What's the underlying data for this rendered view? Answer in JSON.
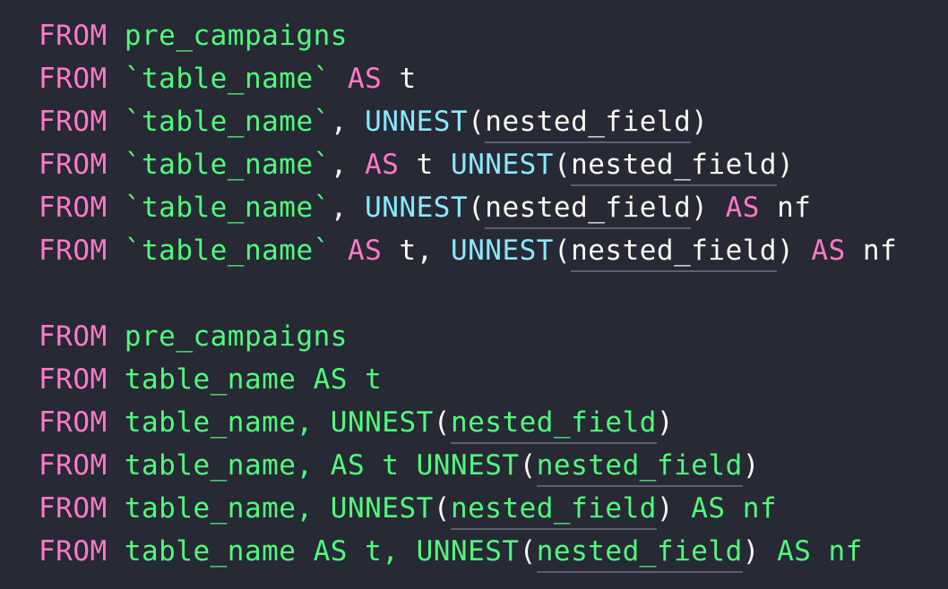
{
  "colors": {
    "background": "#272935",
    "keyword": "#ff79c6",
    "string": "#50fa7b",
    "function": "#8be9fd",
    "plain": "#f8f8f2",
    "underline": "#5b5f70"
  },
  "lines": [
    {
      "tokens": [
        {
          "t": "FROM",
          "c": "kw"
        },
        {
          "t": " ",
          "c": "plain"
        },
        {
          "t": "pre_campaigns",
          "c": "str"
        }
      ]
    },
    {
      "tokens": [
        {
          "t": "FROM",
          "c": "kw"
        },
        {
          "t": " ",
          "c": "plain"
        },
        {
          "t": "`table_name`",
          "c": "str"
        },
        {
          "t": " ",
          "c": "plain"
        },
        {
          "t": "AS",
          "c": "kw"
        },
        {
          "t": " t",
          "c": "plain"
        }
      ]
    },
    {
      "tokens": [
        {
          "t": "FROM",
          "c": "kw"
        },
        {
          "t": " ",
          "c": "plain"
        },
        {
          "t": "`table_name`",
          "c": "str"
        },
        {
          "t": ", ",
          "c": "plain"
        },
        {
          "t": "UNNEST",
          "c": "fn"
        },
        {
          "t": "(",
          "c": "plain"
        },
        {
          "t": "nested_field",
          "c": "plain",
          "u": true
        },
        {
          "t": ")",
          "c": "plain"
        }
      ]
    },
    {
      "tokens": [
        {
          "t": "FROM",
          "c": "kw"
        },
        {
          "t": " ",
          "c": "plain"
        },
        {
          "t": "`table_name`",
          "c": "str"
        },
        {
          "t": ", ",
          "c": "plain"
        },
        {
          "t": "AS",
          "c": "kw"
        },
        {
          "t": " t ",
          "c": "plain"
        },
        {
          "t": "UNNEST",
          "c": "fn"
        },
        {
          "t": "(",
          "c": "plain"
        },
        {
          "t": "nested_field",
          "c": "plain",
          "u": true
        },
        {
          "t": ")",
          "c": "plain"
        }
      ]
    },
    {
      "tokens": [
        {
          "t": "FROM",
          "c": "kw"
        },
        {
          "t": " ",
          "c": "plain"
        },
        {
          "t": "`table_name`",
          "c": "str"
        },
        {
          "t": ", ",
          "c": "plain"
        },
        {
          "t": "UNNEST",
          "c": "fn"
        },
        {
          "t": "(",
          "c": "plain"
        },
        {
          "t": "nested_field",
          "c": "plain",
          "u": true
        },
        {
          "t": ") ",
          "c": "plain"
        },
        {
          "t": "AS",
          "c": "kw"
        },
        {
          "t": " nf",
          "c": "plain"
        }
      ]
    },
    {
      "tokens": [
        {
          "t": "FROM",
          "c": "kw"
        },
        {
          "t": " ",
          "c": "plain"
        },
        {
          "t": "`table_name`",
          "c": "str"
        },
        {
          "t": " ",
          "c": "plain"
        },
        {
          "t": "AS",
          "c": "kw"
        },
        {
          "t": " t, ",
          "c": "plain"
        },
        {
          "t": "UNNEST",
          "c": "fn"
        },
        {
          "t": "(",
          "c": "plain"
        },
        {
          "t": "nested_field",
          "c": "plain",
          "u": true
        },
        {
          "t": ") ",
          "c": "plain"
        },
        {
          "t": "AS",
          "c": "kw"
        },
        {
          "t": " nf",
          "c": "plain"
        }
      ]
    },
    {
      "tokens": []
    },
    {
      "tokens": [
        {
          "t": "FROM",
          "c": "kw"
        },
        {
          "t": " ",
          "c": "plain"
        },
        {
          "t": "pre_campaigns",
          "c": "str"
        }
      ]
    },
    {
      "tokens": [
        {
          "t": "FROM",
          "c": "kw"
        },
        {
          "t": " ",
          "c": "plain"
        },
        {
          "t": "table_name AS t",
          "c": "str"
        }
      ]
    },
    {
      "tokens": [
        {
          "t": "FROM",
          "c": "kw"
        },
        {
          "t": " ",
          "c": "plain"
        },
        {
          "t": "table_name, UNNEST",
          "c": "str"
        },
        {
          "t": "(",
          "c": "plain"
        },
        {
          "t": "nested_field",
          "c": "str",
          "u": true
        },
        {
          "t": ")",
          "c": "plain"
        }
      ]
    },
    {
      "tokens": [
        {
          "t": "FROM",
          "c": "kw"
        },
        {
          "t": " ",
          "c": "plain"
        },
        {
          "t": "table_name, AS t UNNEST",
          "c": "str"
        },
        {
          "t": "(",
          "c": "plain"
        },
        {
          "t": "nested_field",
          "c": "str",
          "u": true
        },
        {
          "t": ")",
          "c": "plain"
        }
      ]
    },
    {
      "tokens": [
        {
          "t": "FROM",
          "c": "kw"
        },
        {
          "t": " ",
          "c": "plain"
        },
        {
          "t": "table_name, UNNEST",
          "c": "str"
        },
        {
          "t": "(",
          "c": "plain"
        },
        {
          "t": "nested_field",
          "c": "str",
          "u": true
        },
        {
          "t": ") ",
          "c": "plain"
        },
        {
          "t": "AS nf",
          "c": "str"
        }
      ]
    },
    {
      "tokens": [
        {
          "t": "FROM",
          "c": "kw"
        },
        {
          "t": " ",
          "c": "plain"
        },
        {
          "t": "table_name AS t, UNNEST",
          "c": "str"
        },
        {
          "t": "(",
          "c": "plain"
        },
        {
          "t": "nested_field",
          "c": "str",
          "u": true
        },
        {
          "t": ") ",
          "c": "plain"
        },
        {
          "t": "AS nf",
          "c": "str"
        }
      ]
    }
  ]
}
